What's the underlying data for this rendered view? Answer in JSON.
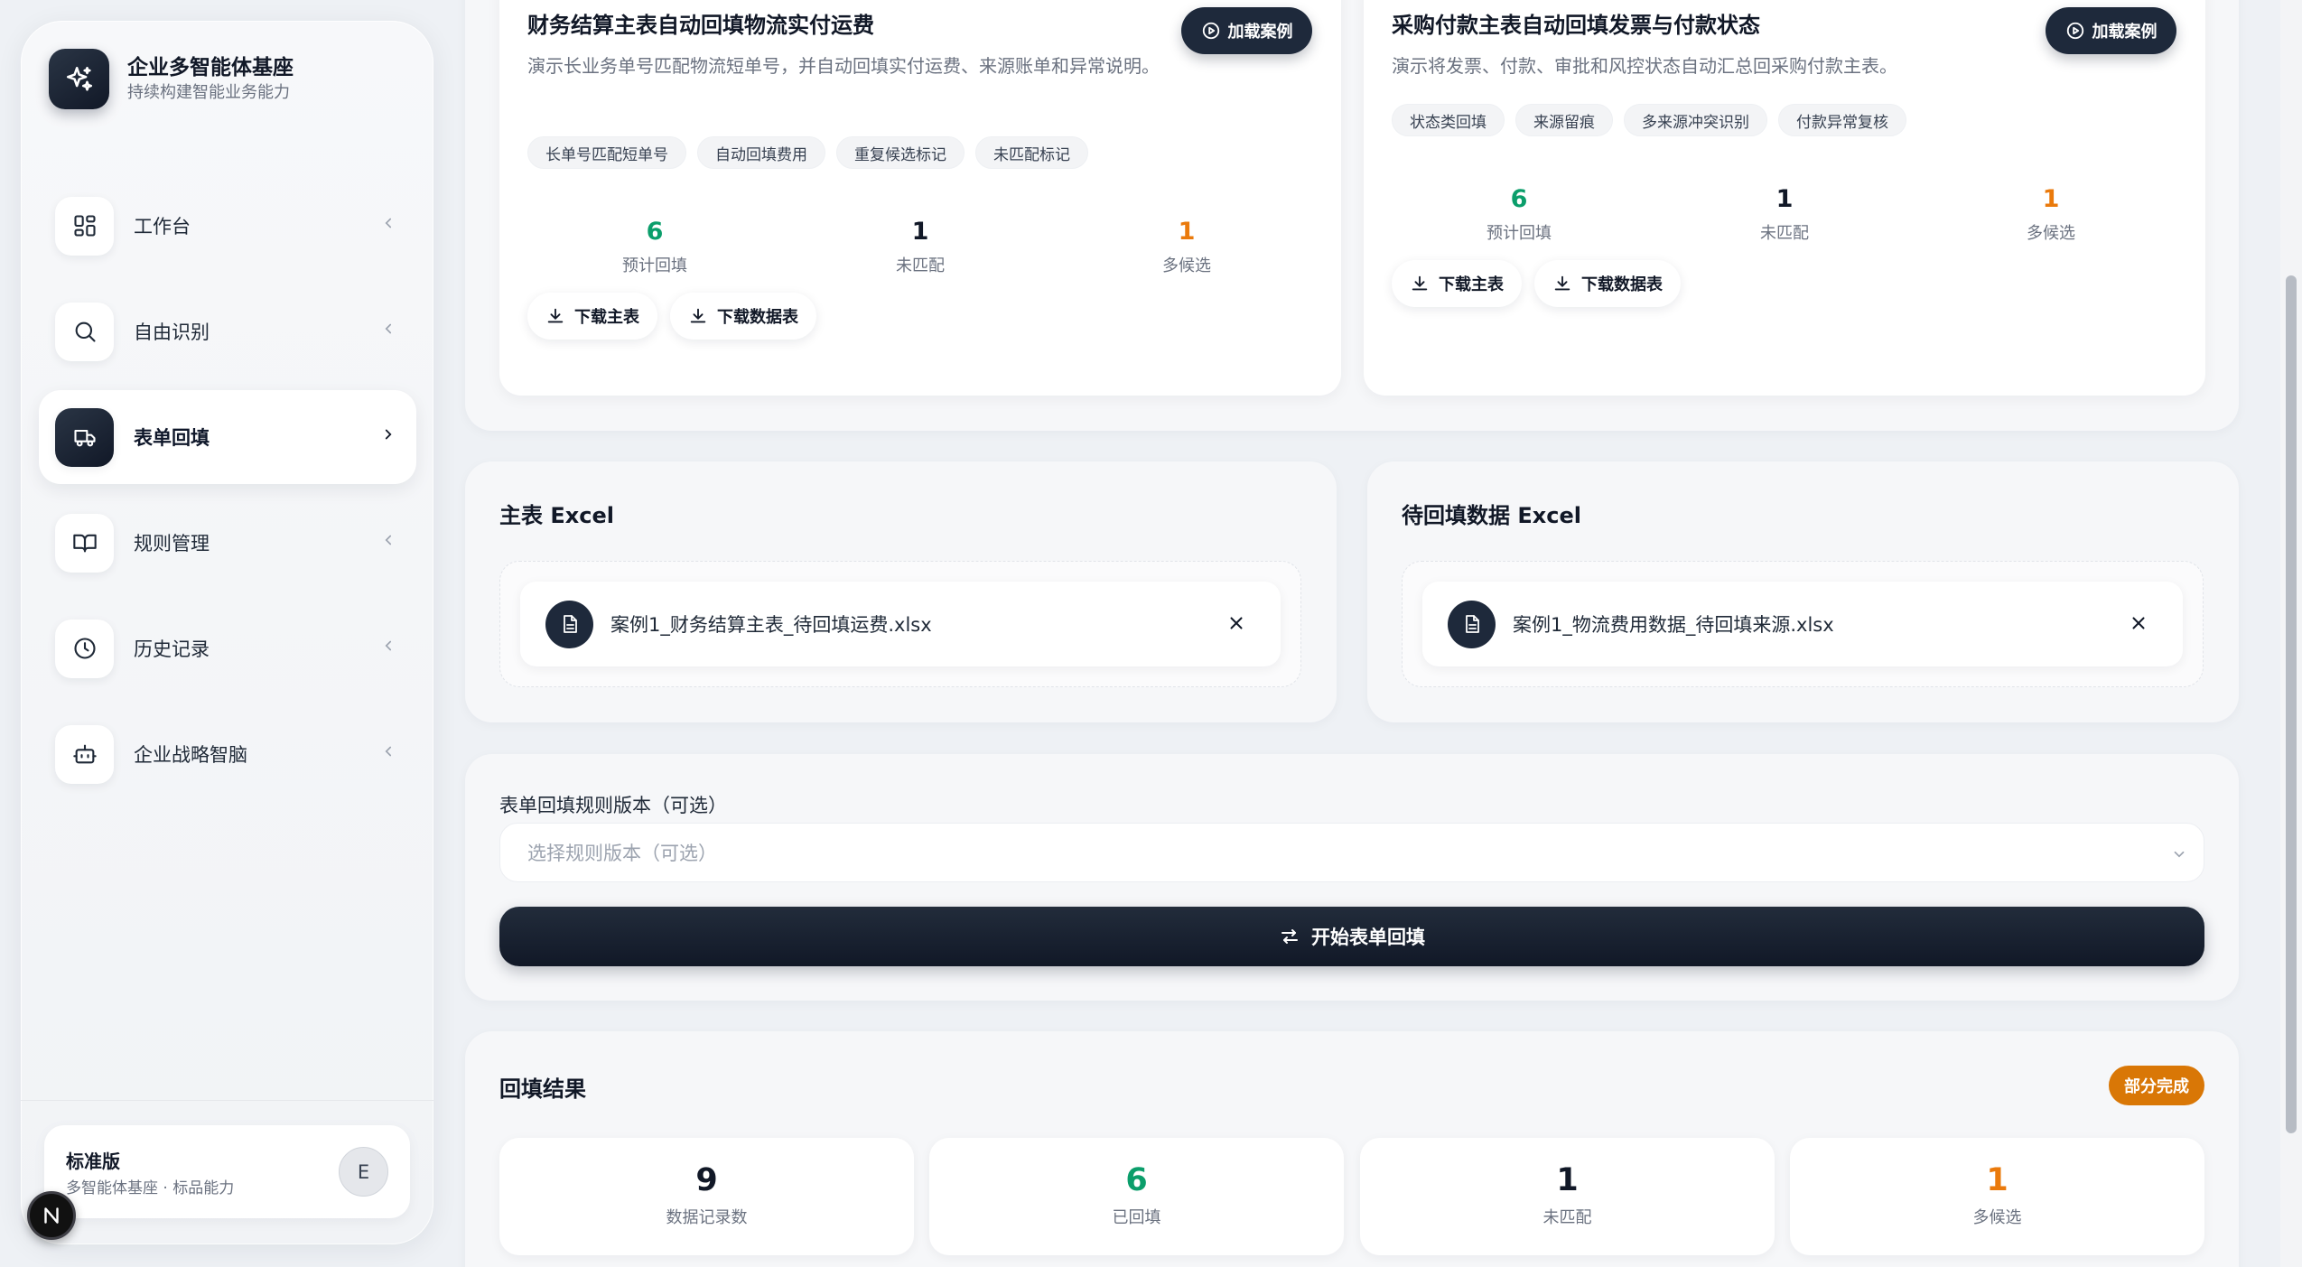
{
  "brand": {
    "title": "企业多智能体基座",
    "subtitle": "持续构建智能业务能力"
  },
  "nav": [
    {
      "label": "工作台",
      "icon": "dashboard-icon",
      "active": false
    },
    {
      "label": "自由识别",
      "icon": "search-icon",
      "active": false
    },
    {
      "label": "表单回填",
      "icon": "truck-icon",
      "active": true
    },
    {
      "label": "规则管理",
      "icon": "book-icon",
      "active": false
    },
    {
      "label": "历史记录",
      "icon": "clock-icon",
      "active": false
    },
    {
      "label": "企业战略智脑",
      "icon": "bot-icon",
      "active": false
    }
  ],
  "plan": {
    "title": "标准版",
    "subtitle": "多智能体基座 · 标品能力",
    "avatar": "E"
  },
  "cases": [
    {
      "title": "财务结算主表自动回填物流实付运费",
      "description": "演示长业务单号匹配物流短单号，并自动回填实付运费、来源账单和异常说明。",
      "load_label": "加载案例",
      "tags": [
        "长单号匹配短单号",
        "自动回填费用",
        "重复候选标记",
        "未匹配标记"
      ],
      "stats": [
        {
          "value": "6",
          "label": "预计回填",
          "color": "#0b9e6b"
        },
        {
          "value": "1",
          "label": "未匹配",
          "color": "#111827"
        },
        {
          "value": "1",
          "label": "多候选",
          "color": "#ea7a0c"
        }
      ],
      "downloads": [
        "下载主表",
        "下载数据表"
      ]
    },
    {
      "title": "采购付款主表自动回填发票与付款状态",
      "description": "演示将发票、付款、审批和风控状态自动汇总回采购付款主表。",
      "load_label": "加载案例",
      "tags": [
        "状态类回填",
        "来源留痕",
        "多来源冲突识别",
        "付款异常复核"
      ],
      "stats": [
        {
          "value": "6",
          "label": "预计回填",
          "color": "#0b9e6b"
        },
        {
          "value": "1",
          "label": "未匹配",
          "color": "#111827"
        },
        {
          "value": "1",
          "label": "多候选",
          "color": "#ea7a0c"
        }
      ],
      "downloads": [
        "下载主表",
        "下载数据表"
      ]
    }
  ],
  "uploads": {
    "master": {
      "title": "主表 Excel",
      "file_name": "案例1_财务结算主表_待回填运费.xlsx"
    },
    "source": {
      "title": "待回填数据 Excel",
      "file_name": "案例1_物流费用数据_待回填来源.xlsx"
    }
  },
  "rule": {
    "label": "表单回填规则版本（可选）",
    "placeholder": "选择规则版本（可选）",
    "start_label": "开始表单回填"
  },
  "results": {
    "title": "回填结果",
    "status": "部分完成",
    "status_color": "#d97706",
    "cards": [
      {
        "value": "9",
        "label": "数据记录数",
        "color": "#111827"
      },
      {
        "value": "6",
        "label": "已回填",
        "color": "#0b9e6b"
      },
      {
        "value": "1",
        "label": "未匹配",
        "color": "#111827"
      },
      {
        "value": "1",
        "label": "多候选",
        "color": "#ea7a0c"
      }
    ]
  },
  "fab": {
    "label": "N"
  }
}
